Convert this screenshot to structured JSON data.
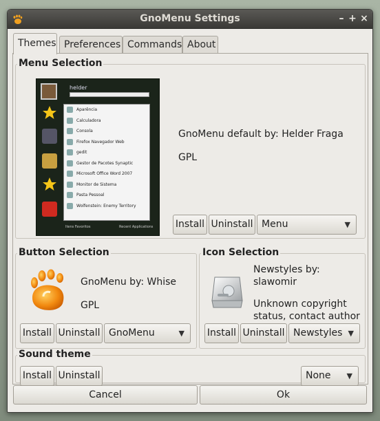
{
  "window": {
    "title": "GnoMenu Settings",
    "controls": {
      "minimize": "–",
      "maximize": "+",
      "close": "×"
    }
  },
  "tabs": [
    {
      "label": "Themes",
      "active": true
    },
    {
      "label": "Preferences",
      "active": false
    },
    {
      "label": "Commands",
      "active": false
    },
    {
      "label": "About",
      "active": false
    }
  ],
  "menu_selection": {
    "label": "Menu Selection",
    "author_text": "GnoMenu default by: Helder Fraga",
    "license": "GPL",
    "install_label": "Install",
    "uninstall_label": "Uninstall",
    "theme_value": "Menu",
    "preview": {
      "user": "helder",
      "items": [
        "Aparência",
        "Calculadora",
        "Consola",
        "Firefox Navegador Web",
        "gedit",
        "Gestor de Pacotes Synaptic",
        "Microsoft Office Word 2007",
        "Monitor de Sistema",
        "Pasta Pessoal",
        "Wolfenstein: Enemy Territory"
      ],
      "footer_left": "Itens Favoritos",
      "footer_right": "Recent Applications"
    }
  },
  "button_selection": {
    "label": "Button Selection",
    "author_text": "GnoMenu by: Whise",
    "license": "GPL",
    "install_label": "Install",
    "uninstall_label": "Uninstall",
    "theme_value": "GnoMenu"
  },
  "icon_selection": {
    "label": "Icon Selection",
    "author_text": "Newstyles by:\nslawomir",
    "license": "Unknown copyright\nstatus, contact author",
    "install_label": "Install",
    "uninstall_label": "Uninstall",
    "theme_value": "Newstyles"
  },
  "sound_theme": {
    "label": "Sound theme",
    "install_label": "Install",
    "uninstall_label": "Uninstall",
    "theme_value": "None"
  },
  "footer": {
    "cancel_label": "Cancel",
    "ok_label": "Ok"
  },
  "colors": {
    "window_bg": "#edebe7",
    "titlebar": "#3a3936",
    "gnomenu_orange": "#f08a10"
  },
  "icons": {
    "app": "gnome-foot-icon",
    "combo_arrow": "triangle-down-icon",
    "icon_theme_preview": "hard-drive-icon"
  }
}
